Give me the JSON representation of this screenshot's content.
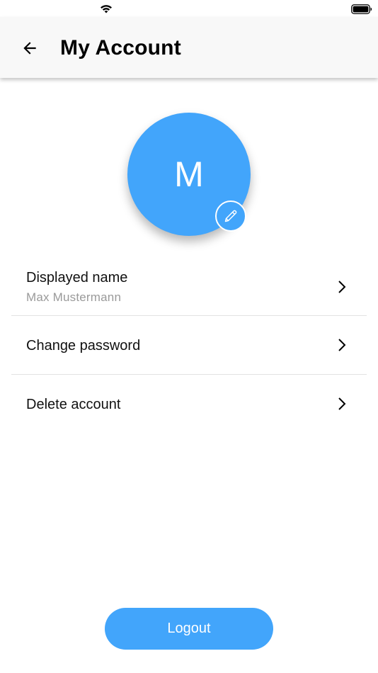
{
  "app_bar": {
    "title": "My Account"
  },
  "avatar": {
    "initial": "M",
    "color": "#42a5fb"
  },
  "menu": {
    "items": [
      {
        "title": "Displayed name",
        "subtitle": "Max Mustermann"
      },
      {
        "title": "Change password"
      },
      {
        "title": "Delete account"
      }
    ]
  },
  "logout": {
    "label": "Logout"
  },
  "icons": {
    "back": "arrow-back-icon",
    "edit": "pencil-icon",
    "chevron": "chevron-right-icon",
    "wifi": "wifi-icon",
    "battery": "battery-icon"
  }
}
